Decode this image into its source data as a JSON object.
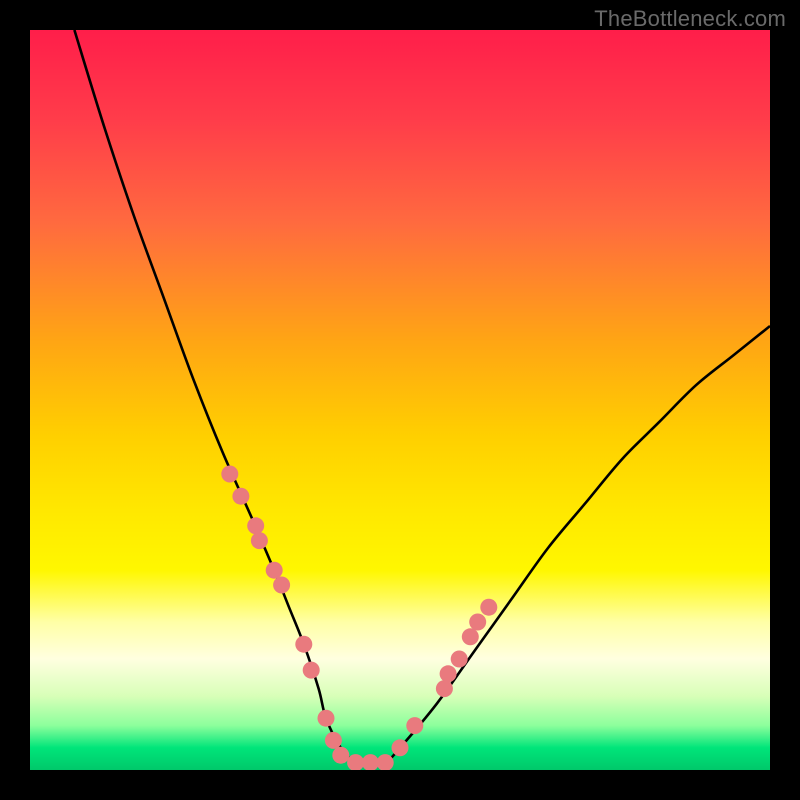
{
  "watermark": "TheBottleneck.com",
  "chart_data": {
    "type": "line",
    "title": "",
    "xlabel": "",
    "ylabel": "",
    "ylim": [
      0,
      100
    ],
    "xlim": [
      0,
      100
    ],
    "series": [
      {
        "name": "bottleneck-curve",
        "x": [
          6,
          10,
          14,
          18,
          22,
          26,
          30,
          33,
          35,
          37,
          39,
          40,
          42,
          44,
          46,
          48,
          50,
          55,
          60,
          65,
          70,
          75,
          80,
          85,
          90,
          95,
          100
        ],
        "y": [
          100,
          87,
          75,
          64,
          53,
          43,
          34,
          27,
          22,
          17,
          11,
          7,
          3,
          1,
          1,
          1,
          3,
          9,
          16,
          23,
          30,
          36,
          42,
          47,
          52,
          56,
          60
        ]
      }
    ],
    "markers_left": {
      "name": "left-branch-points",
      "x": [
        27,
        28.5,
        30.5,
        31,
        33,
        34,
        37,
        38,
        40,
        41,
        42
      ],
      "y": [
        40,
        37,
        33,
        31,
        27,
        25,
        17,
        13.5,
        7,
        4,
        2
      ]
    },
    "markers_right": {
      "name": "right-branch-points",
      "x": [
        44,
        46,
        48,
        50,
        52,
        56,
        56.5,
        58,
        59.5,
        60.5,
        62
      ],
      "y": [
        1,
        1,
        1,
        3,
        6,
        11,
        13,
        15,
        18,
        20,
        22
      ]
    },
    "marker_color": "#e97a7e",
    "curve_color": "#000000"
  }
}
